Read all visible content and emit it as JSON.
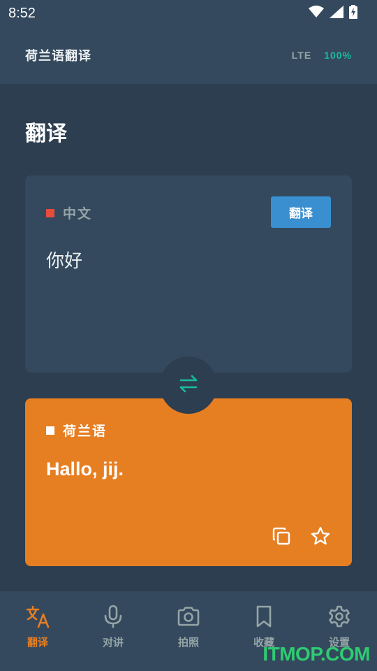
{
  "status_bar": {
    "time": "8:52"
  },
  "header": {
    "app_title": "荷兰语翻译",
    "network": "LTE",
    "battery": "100%"
  },
  "page": {
    "title": "翻译"
  },
  "source": {
    "language": "中文",
    "translate_button": "翻译",
    "text": "你好",
    "indicator_color": "#e74c3c"
  },
  "target": {
    "language": "荷兰语",
    "text": "Hallo, jij.",
    "indicator_color": "#ffffff",
    "card_color": "#e67e22"
  },
  "icons": {
    "swap": "swap-arrows-icon",
    "copy": "copy-icon",
    "favorite": "star-icon"
  },
  "bottom_nav": {
    "items": [
      {
        "label": "翻译",
        "icon": "translate-icon",
        "active": true
      },
      {
        "label": "对讲",
        "icon": "microphone-icon",
        "active": false
      },
      {
        "label": "拍照",
        "icon": "camera-icon",
        "active": false
      },
      {
        "label": "收藏",
        "icon": "bookmark-icon",
        "active": false
      },
      {
        "label": "设置",
        "icon": "gear-icon",
        "active": false
      }
    ]
  },
  "colors": {
    "accent": "#e67e22",
    "teal": "#1abc9c",
    "button_blue": "#3a8fd0",
    "background": "#2c3e50",
    "surface": "#34495e"
  },
  "watermark": "ITMOP.COM"
}
